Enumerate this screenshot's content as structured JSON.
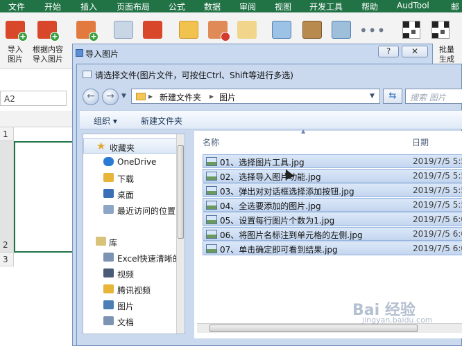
{
  "ribbon": {
    "tabs": [
      "文件",
      "开始",
      "插入",
      "页面布局",
      "公式",
      "数据",
      "审阅",
      "视图",
      "开发工具",
      "帮助",
      "AudTool",
      "邮件"
    ],
    "buttons": [
      {
        "label": "导入\n图片",
        "icon": "import-picture-icon"
      },
      {
        "label": "根据内容\n导入图片",
        "icon": "import-by-content-icon"
      },
      {
        "label": "",
        "icon": "picture-add-icon"
      },
      {
        "label": "",
        "icon": "link-picture-icon"
      },
      {
        "label": "",
        "icon": "picture-download-icon"
      },
      {
        "label": "",
        "icon": "folder-picture-icon"
      },
      {
        "label": "",
        "icon": "picture-remove-icon"
      },
      {
        "label": "",
        "icon": "picture-edit-icon"
      },
      {
        "label": "",
        "icon": "picture-frame-icon"
      },
      {
        "label": "",
        "icon": "landscape-picture-icon"
      },
      {
        "label": "",
        "icon": "picture-grid-icon"
      },
      {
        "label": "",
        "icon": "more-icon"
      },
      {
        "label": "批量\n生成",
        "icon": "qrcode-icon"
      }
    ]
  },
  "sheet": {
    "namebox": "A2",
    "rows": [
      "1",
      "2",
      "3"
    ]
  },
  "import_dialog": {
    "title": "导入图片",
    "help_label": "?",
    "close_label": "✕"
  },
  "file_dialog": {
    "title": "请选择文件(图片文件，可按住Ctrl、Shift等进行多选)",
    "path": [
      "新建文件夹",
      "图片"
    ],
    "search_placeholder": "搜索 图片",
    "toolbar": {
      "organize": "组织 ▾",
      "new_folder": "新建文件夹"
    },
    "nav": {
      "favorites_label": "收藏夹",
      "items": [
        {
          "label": "OneDrive",
          "icon": "cloud-icon",
          "color": "#2a7bd4"
        },
        {
          "label": "下载",
          "icon": "download-folder-icon",
          "color": "#e6b53a"
        },
        {
          "label": "桌面",
          "icon": "desktop-icon",
          "color": "#3a6fb8"
        },
        {
          "label": "最近访问的位置",
          "icon": "recent-places-icon",
          "color": "#8ea6c6"
        }
      ],
      "library_label": "库",
      "library_items": [
        {
          "label": "Excel快速清晰的",
          "icon": "document-icon",
          "color": "#7c93b4"
        },
        {
          "label": "视频",
          "icon": "video-library-icon",
          "color": "#4a5b78"
        },
        {
          "label": "腾讯视频",
          "icon": "tencent-video-folder-icon",
          "color": "#e6b53a"
        },
        {
          "label": "图片",
          "icon": "pictures-library-icon",
          "color": "#4b7db6"
        },
        {
          "label": "文档",
          "icon": "documents-library-icon",
          "color": "#7c93b4"
        }
      ]
    },
    "columns": {
      "name": "名称",
      "date": "日期"
    },
    "files": [
      {
        "name": "01、选择图片工具.jpg",
        "date": "2019/7/5 5:5"
      },
      {
        "name": "02、选择导入图片功能.jpg",
        "date": "2019/7/5 5:5"
      },
      {
        "name": "03、弹出对对话框选择添加按钮.jpg",
        "date": "2019/7/5 5:5"
      },
      {
        "name": "04、全选要添加的图片.jpg",
        "date": "2019/7/5 5:5"
      },
      {
        "name": "05、设置每行图片个数为1.jpg",
        "date": "2019/7/5 6:0"
      },
      {
        "name": "06、将图片名标注到单元格的左侧.jpg",
        "date": "2019/7/5 6:0"
      },
      {
        "name": "07、单击确定即可看到结果.jpg",
        "date": "2019/7/5 6:0"
      }
    ]
  },
  "watermark": {
    "text": "Bai 经验",
    "sub": "jingyan.baidu.com"
  }
}
